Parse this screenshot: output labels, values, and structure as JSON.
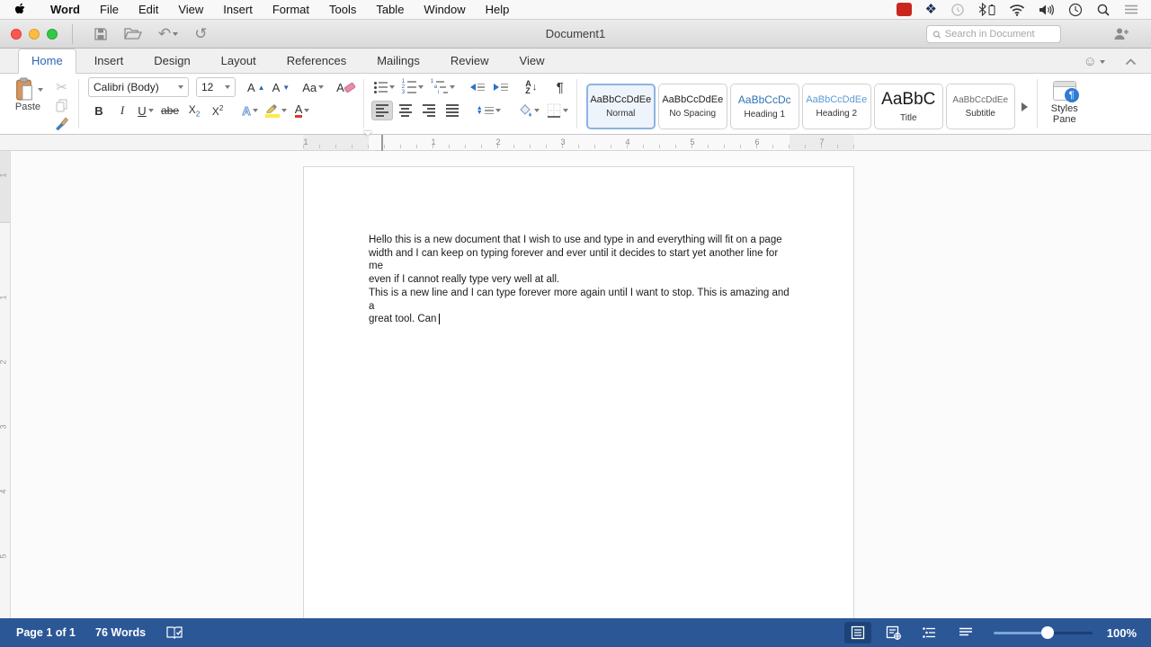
{
  "menubar": {
    "items": [
      "Word",
      "File",
      "Edit",
      "View",
      "Insert",
      "Format",
      "Tools",
      "Table",
      "Window",
      "Help"
    ]
  },
  "titlebar": {
    "title": "Document1",
    "search_placeholder": "Search in Document"
  },
  "tabs": {
    "items": [
      "Home",
      "Insert",
      "Design",
      "Layout",
      "References",
      "Mailings",
      "Review",
      "View"
    ],
    "active": "Home"
  },
  "ribbon": {
    "paste_label": "Paste",
    "font_name": "Calibri (Body)",
    "font_size": "12",
    "bold": "B",
    "italic": "I",
    "underline": "U",
    "strikethrough": "abe",
    "subscript_base": "X",
    "subscript_mark": "2",
    "superscript_base": "X",
    "superscript_mark": "2",
    "grow_font": "A",
    "shrink_font": "A",
    "change_case": "Aa",
    "clear_formatting": "A",
    "text_effects": "A",
    "font_color": "A",
    "sort_a": "A",
    "sort_z": "Z",
    "pilcrow": "¶",
    "styles": [
      {
        "preview": "AaBbCcDdEe",
        "label": "Normal"
      },
      {
        "preview": "AaBbCcDdEe",
        "label": "No Spacing"
      },
      {
        "preview": "AaBbCcDc",
        "label": "Heading 1"
      },
      {
        "preview": "AaBbCcDdEe",
        "label": "Heading 2"
      },
      {
        "preview": "AaBbC",
        "label": "Title"
      },
      {
        "preview": "AaBbCcDdEe",
        "label": "Subtitle"
      }
    ],
    "styles_pane_label": "Styles Pane"
  },
  "ruler": {
    "h_numbers": [
      "1",
      "1",
      "2",
      "3",
      "4",
      "5",
      "6",
      "7"
    ],
    "v_numbers": [
      "1",
      "1",
      "2",
      "3",
      "4",
      "5"
    ]
  },
  "document": {
    "lines": [
      "Hello this is a new document that I wish to use and type in and everything will fit on a page",
      "width and I can keep on typing forever and ever until it decides to start yet another line for me",
      "even if I cannot really type very well at all.",
      "This is a new line and I can type forever more again until I want to stop. This is amazing and a",
      "great tool. Can"
    ]
  },
  "statusbar": {
    "page_indicator": "Page 1 of 1",
    "word_count": "76 Words",
    "zoom_level": "100%"
  },
  "colors": {
    "status_bar_blue": "#2b5797",
    "active_tab_blue": "#2b66b1",
    "heading1_blue": "#2e74b5",
    "heading2_blue": "#5b9bd5",
    "highlight_yellow": "#ffe94d",
    "font_color_red": "#d83a2d"
  }
}
